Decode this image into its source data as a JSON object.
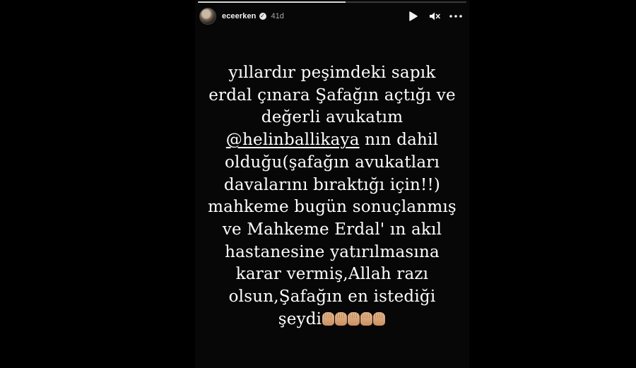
{
  "story": {
    "progress_fraction": 0.55,
    "user": {
      "username": "eceerken",
      "verified": true,
      "time_ago": "41d"
    },
    "controls": [
      "play-icon",
      "mute-icon",
      "more-icon"
    ],
    "text_lines": [
      "yıllardır peşimdeki sapık",
      "erdal çınara Şafağın açtığı ve",
      "değerli avukatım",
      "",
      "olduğu(şafağın avukatları",
      "davalarını bıraktığı için!!)",
      "mahkeme bugün sonuçlanmış",
      "ve Mahkeme Erdal' ın akıl",
      "hastanesine yatırılmasına",
      "karar vermiş,Allah razı",
      "olsun,Şafağın en istediği",
      ""
    ],
    "mention": "@helinballikaya",
    "mention_suffix": " nın dahil",
    "last_line": "şeydi",
    "emoji": "hand-emoji",
    "emoji_count": 5
  }
}
